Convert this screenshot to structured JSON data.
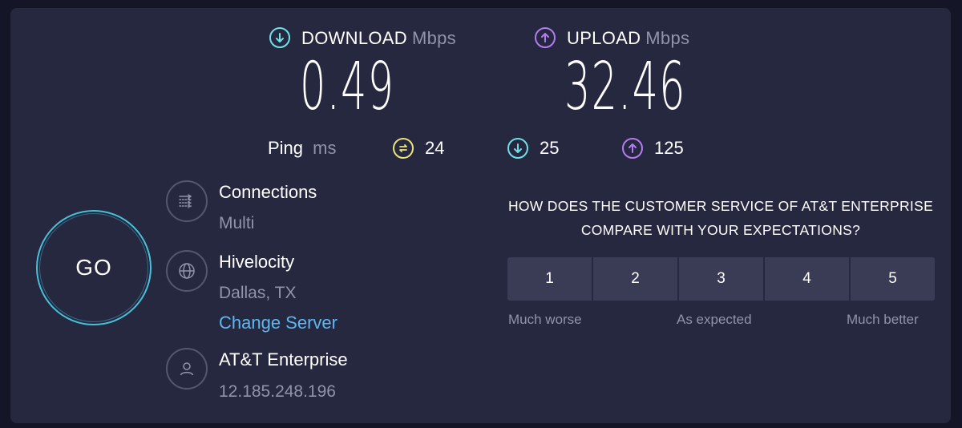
{
  "download": {
    "label": "DOWNLOAD",
    "unit": "Mbps",
    "value": "0.49",
    "icon": "arrow-down-circle-icon",
    "color": "#6fe0e8"
  },
  "upload": {
    "label": "UPLOAD",
    "unit": "Mbps",
    "value": "32.46",
    "icon": "arrow-up-circle-icon",
    "color": "#b47cf0"
  },
  "ping": {
    "label": "Ping",
    "unit": "ms",
    "idle": {
      "value": "24",
      "icon": "ping-idle-icon",
      "color": "#ece47a"
    },
    "download": {
      "value": "25",
      "icon": "arrow-down-circle-icon",
      "color": "#6fe0e8"
    },
    "upload": {
      "value": "125",
      "icon": "arrow-up-circle-icon",
      "color": "#b47cf0"
    }
  },
  "go_button": {
    "label": "GO"
  },
  "connections": {
    "title": "Connections",
    "value": "Multi",
    "icon": "connections-icon"
  },
  "server": {
    "title": "Hivelocity",
    "location": "Dallas, TX",
    "change_label": "Change Server",
    "icon": "globe-icon"
  },
  "provider": {
    "title": "AT&T Enterprise",
    "ip": "12.185.248.196",
    "icon": "user-icon"
  },
  "survey": {
    "question": "HOW DOES THE CUSTOMER SERVICE OF AT&T ENTERPRISE COMPARE WITH YOUR EXPECTATIONS?",
    "options": [
      "1",
      "2",
      "3",
      "4",
      "5"
    ],
    "low_label": "Much worse",
    "mid_label": "As expected",
    "high_label": "Much better"
  },
  "colors": {
    "background": "#141526",
    "panel": "#262840",
    "accent": "#49c0d8",
    "link": "#5cb7f2"
  }
}
